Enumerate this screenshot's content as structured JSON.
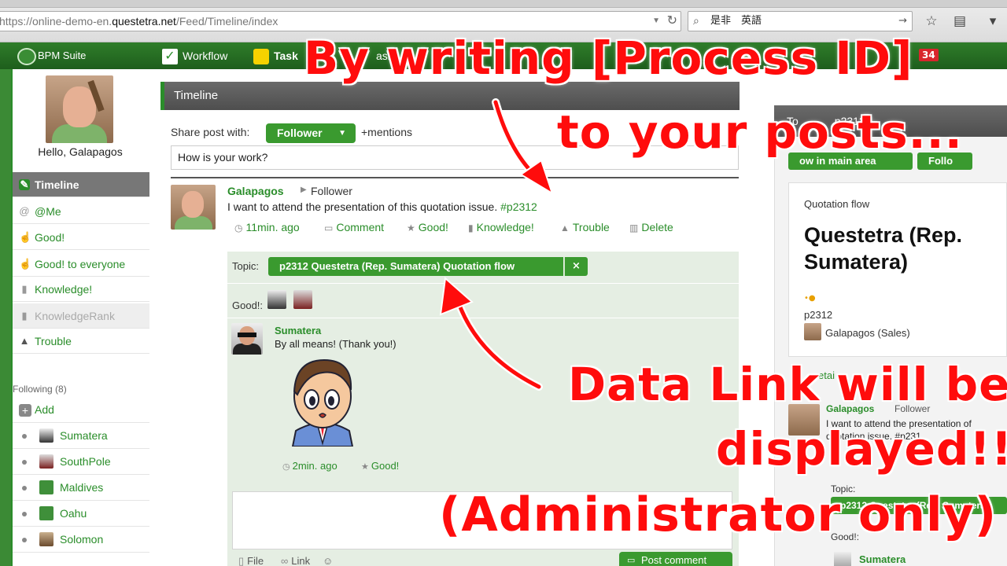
{
  "browser": {
    "url_prefix": "https://online-demo-en.",
    "url_host": "questetra.net",
    "url_path": "/Feed/Timeline/index",
    "search_text": "是非　英語"
  },
  "appbar": {
    "logo_text": "BPM Suite",
    "nav": [
      {
        "label": "Workflow"
      },
      {
        "label": "Task"
      },
      {
        "label": "ash"
      },
      {
        "label": "ts."
      }
    ],
    "badge": "34"
  },
  "sidebar": {
    "greeting": "Hello, Galapagos",
    "items": [
      {
        "label": "Timeline",
        "icon": "chat-icon"
      },
      {
        "label": "@Me",
        "icon": "at-icon"
      },
      {
        "label": "Good!",
        "icon": "thumbs-up-icon"
      },
      {
        "label": "Good! to everyone",
        "icon": "thumbs-up-icon"
      },
      {
        "label": "Knowledge!",
        "icon": "book-icon"
      },
      {
        "label": "KnowledgeRank",
        "icon": "rank-icon"
      },
      {
        "label": "Trouble",
        "icon": "warning-icon"
      }
    ],
    "following_label": "Following (8)",
    "add_label": "Add",
    "following": [
      {
        "name": "Sumatera"
      },
      {
        "name": "SouthPole"
      },
      {
        "name": "Maldives"
      },
      {
        "name": "Oahu"
      },
      {
        "name": "Solomon"
      }
    ]
  },
  "timeline": {
    "header": "Timeline",
    "share_label": "Share post with:",
    "share_target": "Follower",
    "mentions": "+mentions",
    "input_value": "How is your work?",
    "post": {
      "author": "Galapagos",
      "audience": "Follower",
      "text": "I want to attend the presentation of this quotation issue. ",
      "tag": "#p2312",
      "time": "11min. ago",
      "comment": "Comment",
      "good": "Good!",
      "knowledge": "Knowledge!",
      "trouble": "Trouble",
      "delete": "Delete"
    },
    "topic": {
      "label": "Topic:",
      "pill": "p2312 Questetra (Rep. Sumatera) Quotation flow",
      "remove": "×"
    },
    "good_label": "Good!:",
    "reply": {
      "author": "Sumatera",
      "text": "By all means! (Thank you!)",
      "time": "2min. ago",
      "good": "Good!"
    },
    "bottom": {
      "file": "File",
      "link": "Link",
      "post_comment": "Post comment"
    }
  },
  "right": {
    "header": "To",
    "header_tail": "p2312",
    "btn1": "ow in main area",
    "btn2": "Follo",
    "card_label": "Quotation flow",
    "card_title": "Questetra (Rep. Sumatera)",
    "card_dots": "•●",
    "process_id": "p2312",
    "user": "Galapagos (Sales)",
    "detail": "etai",
    "post_author": "Galapagos",
    "post_audience": "Follower",
    "post_text": "I want to attend the presentation of quotation issue. #p231",
    "topic_label": "Topic:",
    "topic_pill": "p2312 Questetra (Rep. Sumatera)",
    "good_label": "Good!:",
    "reply_author": "Sumatera"
  },
  "captions": {
    "line1": "By writing [Process ID]",
    "line2": "to your posts...",
    "line3": "Data Link will be",
    "line4": "displayed!!",
    "line5": "(Administrator only)"
  },
  "colors": {
    "brand_green": "#2a8d2a",
    "button_green": "#3a9a2f",
    "caption_red": "#ff0c0c",
    "header_gray": "#5a5a5a"
  }
}
